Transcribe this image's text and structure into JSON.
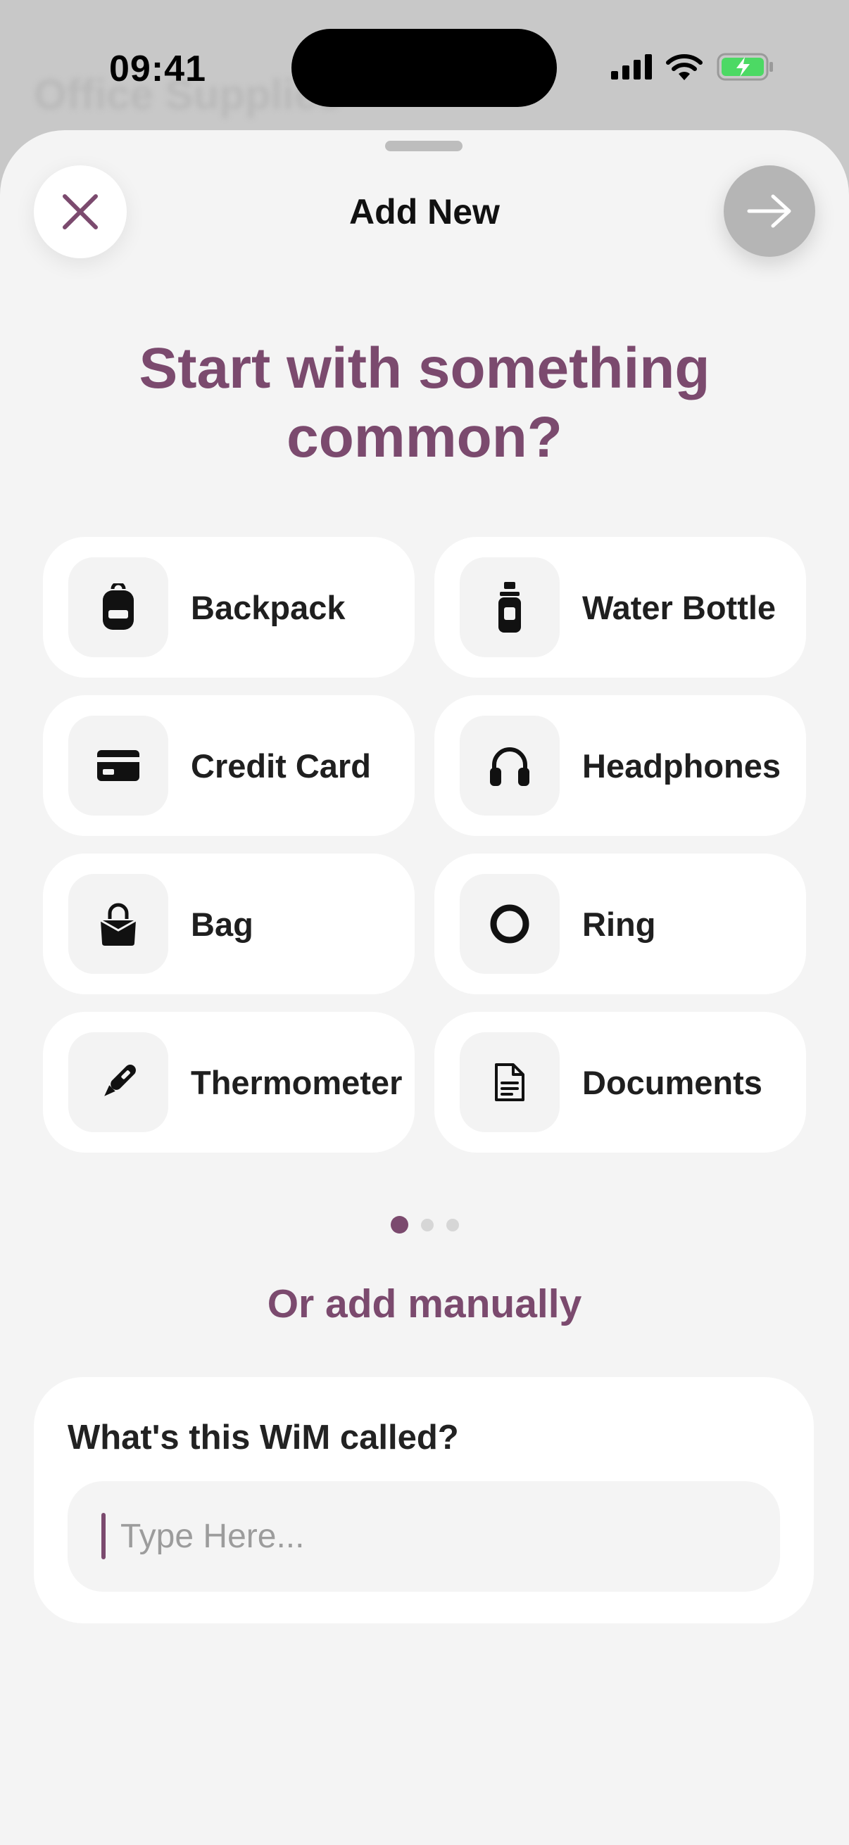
{
  "background": {
    "title": "Office Supplies"
  },
  "status_bar": {
    "time": "09:41"
  },
  "header": {
    "title": "Add New"
  },
  "headline": "Start with something common?",
  "suggestions": [
    {
      "label": "Backpack",
      "icon": "backpack-icon"
    },
    {
      "label": "Water Bottle",
      "icon": "water-bottle-icon"
    },
    {
      "label": "Credit Card",
      "icon": "credit-card-icon"
    },
    {
      "label": "Headphones",
      "icon": "headphones-icon"
    },
    {
      "label": "Bag",
      "icon": "handbag-icon"
    },
    {
      "label": "Ring",
      "icon": "ring-icon"
    },
    {
      "label": "Thermometer",
      "icon": "thermometer-icon"
    },
    {
      "label": "Documents",
      "icon": "document-icon"
    }
  ],
  "pagination": {
    "pages": 3,
    "current": 1
  },
  "manual": {
    "heading": "Or add manually",
    "field_label": "What's this WiM called?",
    "placeholder": "Type Here...",
    "value": ""
  },
  "colors": {
    "accent": "#7b4a6e",
    "sheet": "#f4f4f4",
    "tile": "#ffffff",
    "battery": "#4cd964"
  }
}
